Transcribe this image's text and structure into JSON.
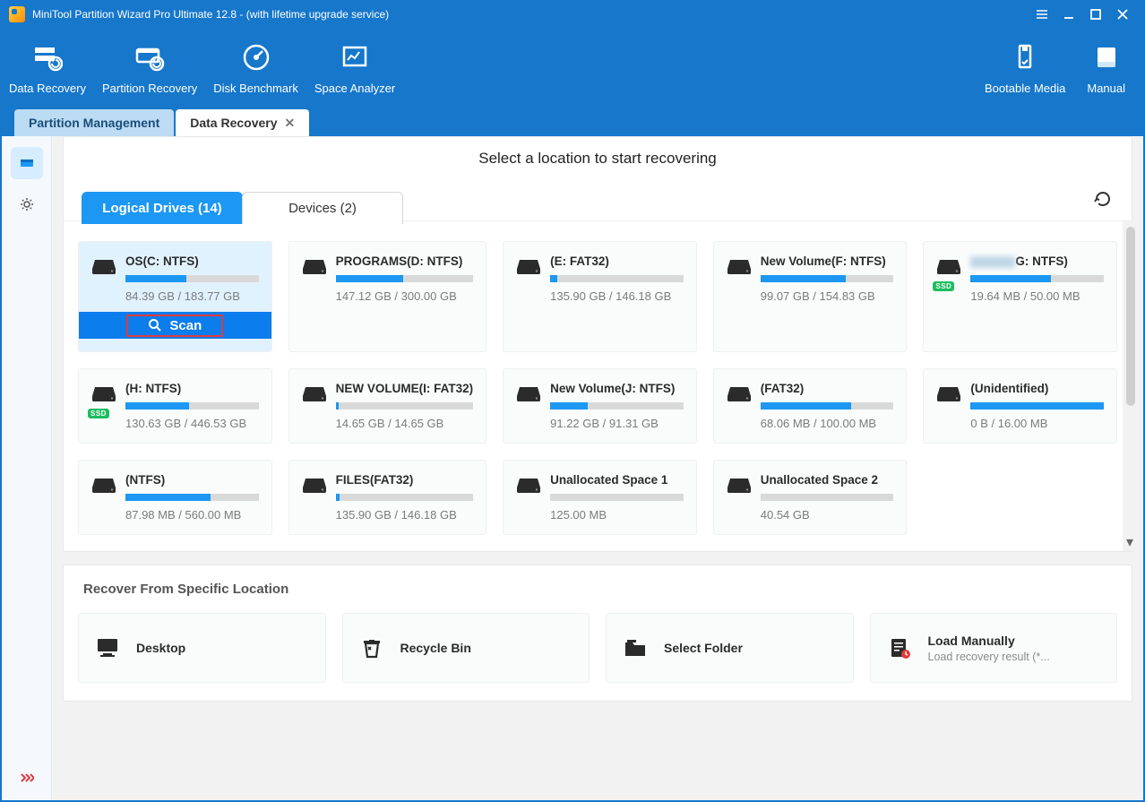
{
  "app": {
    "title": "MiniTool Partition Wizard Pro Ultimate 12.8 - (with lifetime upgrade service)"
  },
  "toolbar": {
    "data_recovery": "Data Recovery",
    "partition_recovery": "Partition Recovery",
    "disk_benchmark": "Disk Benchmark",
    "space_analyzer": "Space Analyzer",
    "bootable_media": "Bootable Media",
    "manual": "Manual"
  },
  "tabs": {
    "partition_mgmt": "Partition Management",
    "data_recovery": "Data Recovery"
  },
  "main": {
    "heading": "Select a location to start recovering",
    "subtabs": {
      "logical": "Logical Drives (14)",
      "devices": "Devices (2)"
    },
    "scan_label": "Scan"
  },
  "drives": [
    {
      "name": "OS(C: NTFS)",
      "size": "84.39 GB / 183.77 GB",
      "fill": 46,
      "selected": true,
      "ssd": false
    },
    {
      "name": "PROGRAMS(D: NTFS)",
      "size": "147.12 GB / 300.00 GB",
      "fill": 49,
      "ssd": false
    },
    {
      "name": "(E: FAT32)",
      "size": "135.90 GB / 146.18 GB",
      "fill": 5,
      "ssd": false
    },
    {
      "name": "New Volume(F: NTFS)",
      "size": "99.07 GB / 154.83 GB",
      "fill": 64,
      "ssd": false
    },
    {
      "name_obscured": true,
      "name_suffix": "G: NTFS)",
      "size": "19.64 MB / 50.00 MB",
      "fill": 60,
      "ssd": true
    },
    {
      "name": "(H: NTFS)",
      "size": "130.63 GB / 446.53 GB",
      "fill": 48,
      "ssd": true
    },
    {
      "name": "NEW VOLUME(I: FAT32)",
      "size": "14.65 GB / 14.65 GB",
      "fill": 2,
      "ssd": false
    },
    {
      "name": "New Volume(J: NTFS)",
      "size": "91.22 GB / 91.31 GB",
      "fill": 28,
      "ssd": false
    },
    {
      "name": "(FAT32)",
      "size": "68.06 MB / 100.00 MB",
      "fill": 68,
      "ssd": false
    },
    {
      "name": "(Unidentified)",
      "size": "0 B / 16.00 MB",
      "fill": 100,
      "ssd": false
    },
    {
      "name": "(NTFS)",
      "size": "87.98 MB / 560.00 MB",
      "fill": 64,
      "ssd": false
    },
    {
      "name": "FILES(FAT32)",
      "size": "135.90 GB / 146.18 GB",
      "fill": 3,
      "ssd": false
    },
    {
      "name": "Unallocated Space 1",
      "size": "125.00 MB",
      "fill": 0,
      "nobar_fill": true,
      "ssd": false
    },
    {
      "name": "Unallocated Space 2",
      "size": "40.54 GB",
      "fill": 0,
      "nobar_fill": true,
      "ssd": false
    }
  ],
  "recover": {
    "title": "Recover From Specific Location",
    "items": [
      {
        "name": "Desktop"
      },
      {
        "name": "Recycle Bin"
      },
      {
        "name": "Select Folder"
      },
      {
        "name": "Load Manually",
        "sub": "Load recovery result (*..."
      }
    ]
  }
}
